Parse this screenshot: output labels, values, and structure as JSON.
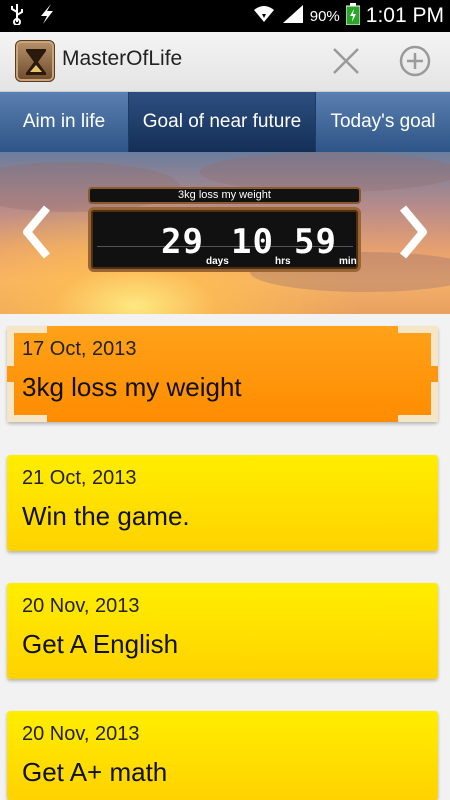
{
  "status_bar": {
    "battery_pct": "90%",
    "time": "1:01 PM",
    "icons": [
      "usb-icon",
      "flash-icon",
      "wifi-icon",
      "signal-icon",
      "battery-charging-icon"
    ]
  },
  "action_bar": {
    "app_icon": "hourglass-icon",
    "title": "MasterOfLife",
    "actions": [
      "close-icon",
      "add-circle-icon"
    ]
  },
  "tabs": [
    {
      "label": "Aim in life",
      "selected": false
    },
    {
      "label": "Goal of near future",
      "selected": true
    },
    {
      "label": "Today's goal",
      "selected": false
    }
  ],
  "countdown": {
    "goal_label": "3kg loss my weight",
    "days": "29",
    "days_unit": "days",
    "hours": "10",
    "hours_unit": "hrs",
    "minutes": "59",
    "minutes_unit": "min"
  },
  "goals": [
    {
      "date": "17 Oct, 2013",
      "title": "3kg loss my weight",
      "selected": true
    },
    {
      "date": "21 Oct, 2013",
      "title": "Win the game.",
      "selected": false
    },
    {
      "date": "20 Nov, 2013",
      "title": "Get A English",
      "selected": false
    },
    {
      "date": "20 Nov, 2013",
      "title": "Get A+ math",
      "selected": false
    }
  ],
  "colors": {
    "tab_bg": "#2e5587",
    "tab_selected_bg": "#142f57",
    "goal_yellow": "#ffe000",
    "goal_selected_orange": "#ff9500"
  }
}
